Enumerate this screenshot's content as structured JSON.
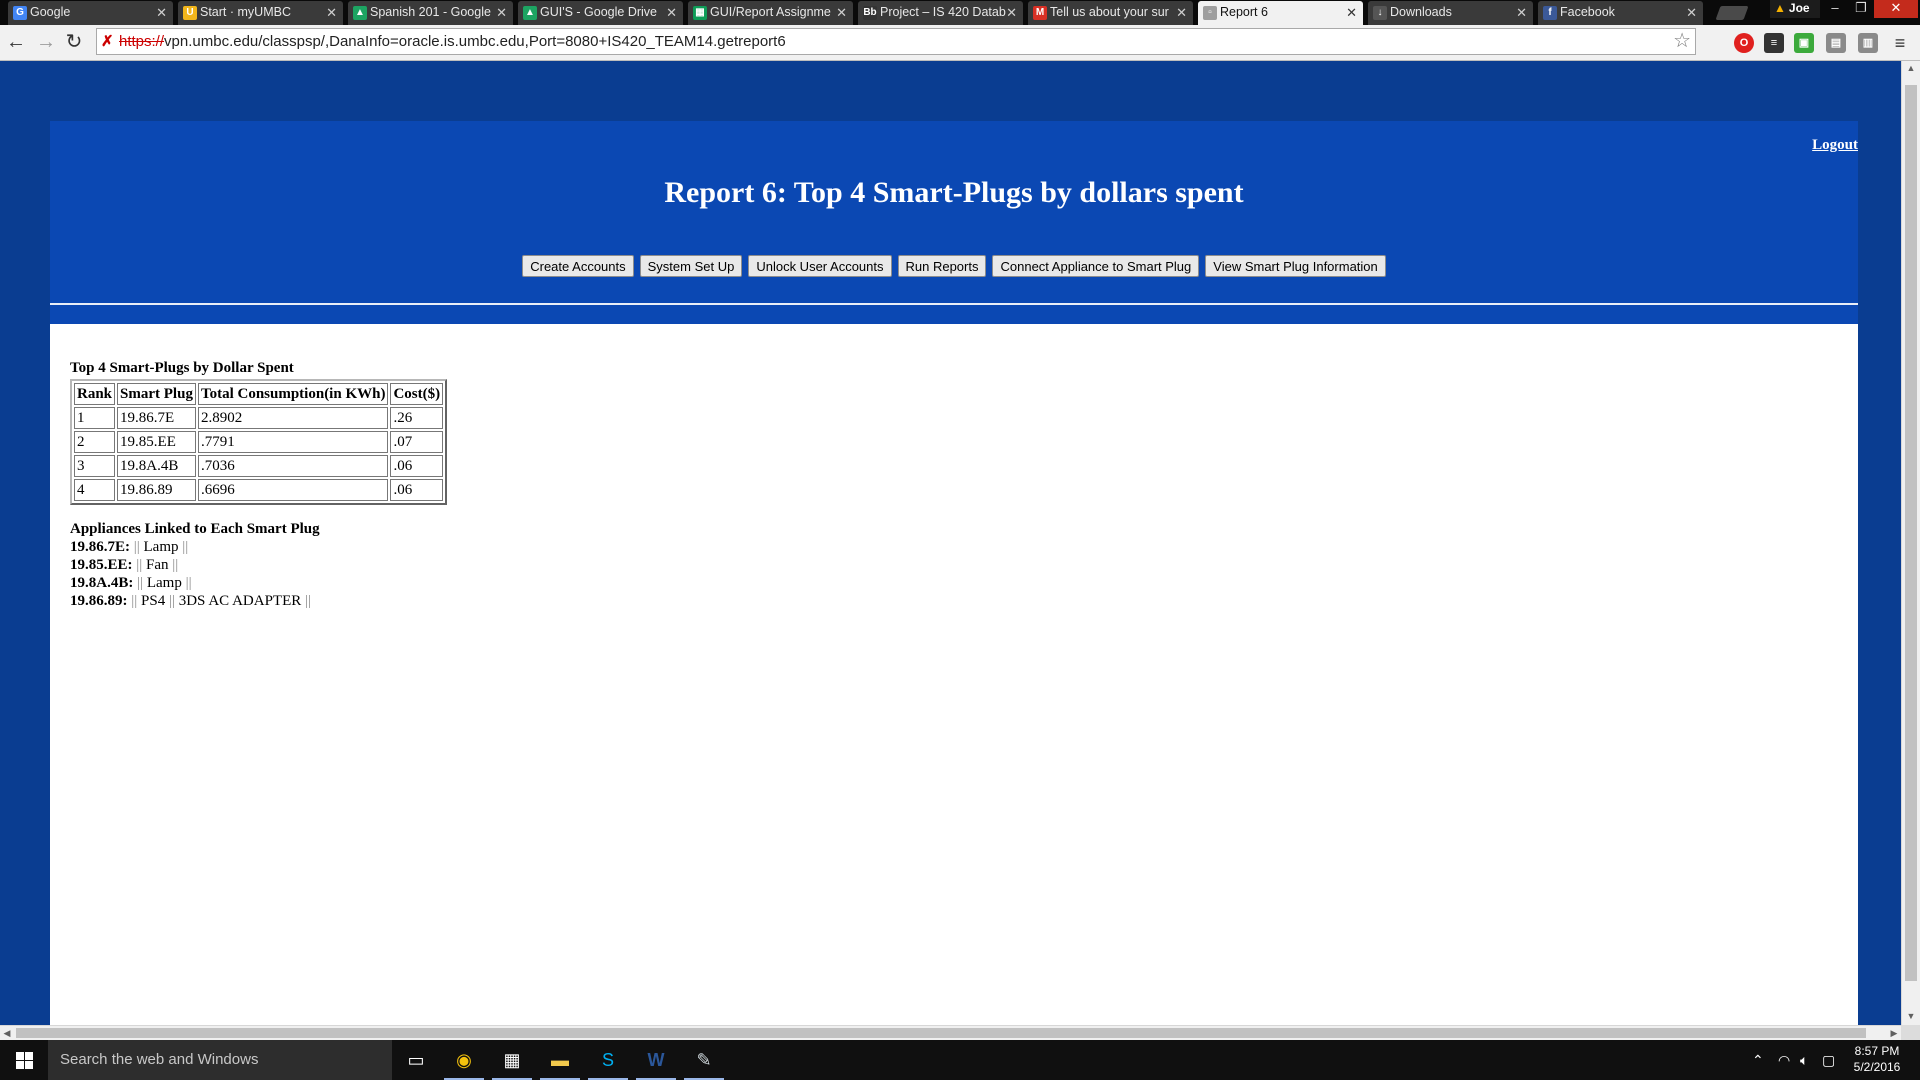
{
  "browser": {
    "tabs": [
      {
        "label": "Google",
        "icon": "google-icon",
        "color": "#4285f4",
        "glyph": "G"
      },
      {
        "label": "Start · myUMBC",
        "icon": "umbc-icon",
        "color": "#f2b61b",
        "glyph": "U"
      },
      {
        "label": "Spanish 201 - Google",
        "icon": "drive-icon",
        "color": "#1da462",
        "glyph": "▲"
      },
      {
        "label": "GUI'S - Google Drive",
        "icon": "drive-icon",
        "color": "#1da462",
        "glyph": "▲"
      },
      {
        "label": "GUI/Report Assignme",
        "icon": "sheets-icon",
        "color": "#0f9d58",
        "glyph": "▦"
      },
      {
        "label": "Project – IS 420 Datab",
        "icon": "blackboard-icon",
        "color": "#333333",
        "glyph": "Bb"
      },
      {
        "label": "Tell us about your sur",
        "icon": "gmail-icon",
        "color": "#d93025",
        "glyph": "M"
      },
      {
        "label": "Report 6",
        "icon": "page-icon",
        "color": "#9e9e9e",
        "glyph": "▫",
        "active": true
      },
      {
        "label": "Downloads",
        "icon": "downloads-icon",
        "color": "#555555",
        "glyph": "↓"
      },
      {
        "label": "Facebook",
        "icon": "facebook-icon",
        "color": "#3b5998",
        "glyph": "f"
      }
    ],
    "user_name": "Joe",
    "url_scheme": "https://",
    "url_rest": "vpn.umbc.edu/classpsp/,DanaInfo=oracle.is.umbc.edu,Port=8080+IS420_TEAM14.getreport6"
  },
  "page": {
    "logout_label": "Logout",
    "title": "Report 6: Top 4 Smart-Plugs by dollars spent",
    "nav_buttons": [
      "Create Accounts",
      "System Set Up",
      "Unlock User Accounts",
      "Run Reports",
      "Connect Appliance to Smart Plug",
      "View Smart Plug Information"
    ],
    "table_caption": "Top 4 Smart-Plugs by Dollar Spent",
    "table_headers": [
      "Rank",
      "Smart Plug",
      "Total Consumption(in KWh)",
      "Cost($)"
    ],
    "table_rows": [
      [
        "1",
        "19.86.7E",
        "2.8902",
        ".26"
      ],
      [
        "2",
        "19.85.EE",
        ".7791",
        ".07"
      ],
      [
        "3",
        "19.8A.4B",
        ".7036",
        ".06"
      ],
      [
        "4",
        "19.86.89",
        ".6696",
        ".06"
      ]
    ],
    "linked_title": "Appliances Linked to Each Smart Plug",
    "linked": [
      {
        "plug": "19.86.7E:",
        "appliances": [
          "Lamp"
        ]
      },
      {
        "plug": "19.85.EE:",
        "appliances": [
          "Fan"
        ]
      },
      {
        "plug": "19.8A.4B:",
        "appliances": [
          "Lamp"
        ]
      },
      {
        "plug": "19.86.89:",
        "appliances": [
          "PS4",
          "3DS AC ADAPTER"
        ]
      }
    ],
    "separator": "||"
  },
  "taskbar": {
    "search_placeholder": "Search the web and Windows",
    "time": "8:57 PM",
    "date": "5/2/2016"
  },
  "colors": {
    "page_background": "#0a3d91",
    "header_background": "#0b48b3"
  }
}
